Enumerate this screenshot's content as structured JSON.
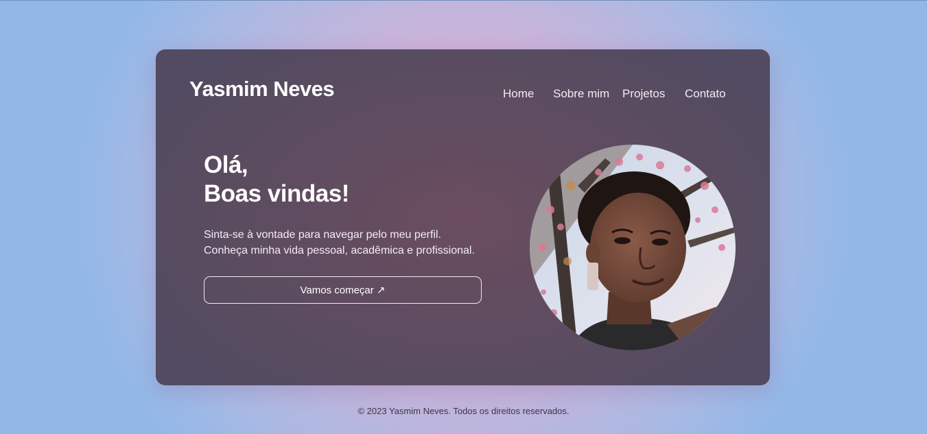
{
  "header": {
    "logo": "Yasmim Neves"
  },
  "nav": {
    "items": [
      {
        "label": "Home"
      },
      {
        "label": "Sobre mim"
      },
      {
        "label": "Projetos"
      },
      {
        "label": "Contato"
      }
    ]
  },
  "hero": {
    "greeting_line1": "Olá,",
    "greeting_line2": "Boas vindas!",
    "text_line1": "Sinta-se à vontade para navegar pelo meu perfil.",
    "text_line2": "Conheça minha vida pessoal, acadêmica e profissional.",
    "cta_label": "Vamos começar ↗"
  },
  "footer": {
    "copyright": "© 2023 Yasmim Neves. Todos os direitos reservados."
  },
  "colors": {
    "background": "#c8b4da",
    "card": "#5e4c60",
    "text": "#ffffff",
    "footer_text": "#3e3545"
  }
}
